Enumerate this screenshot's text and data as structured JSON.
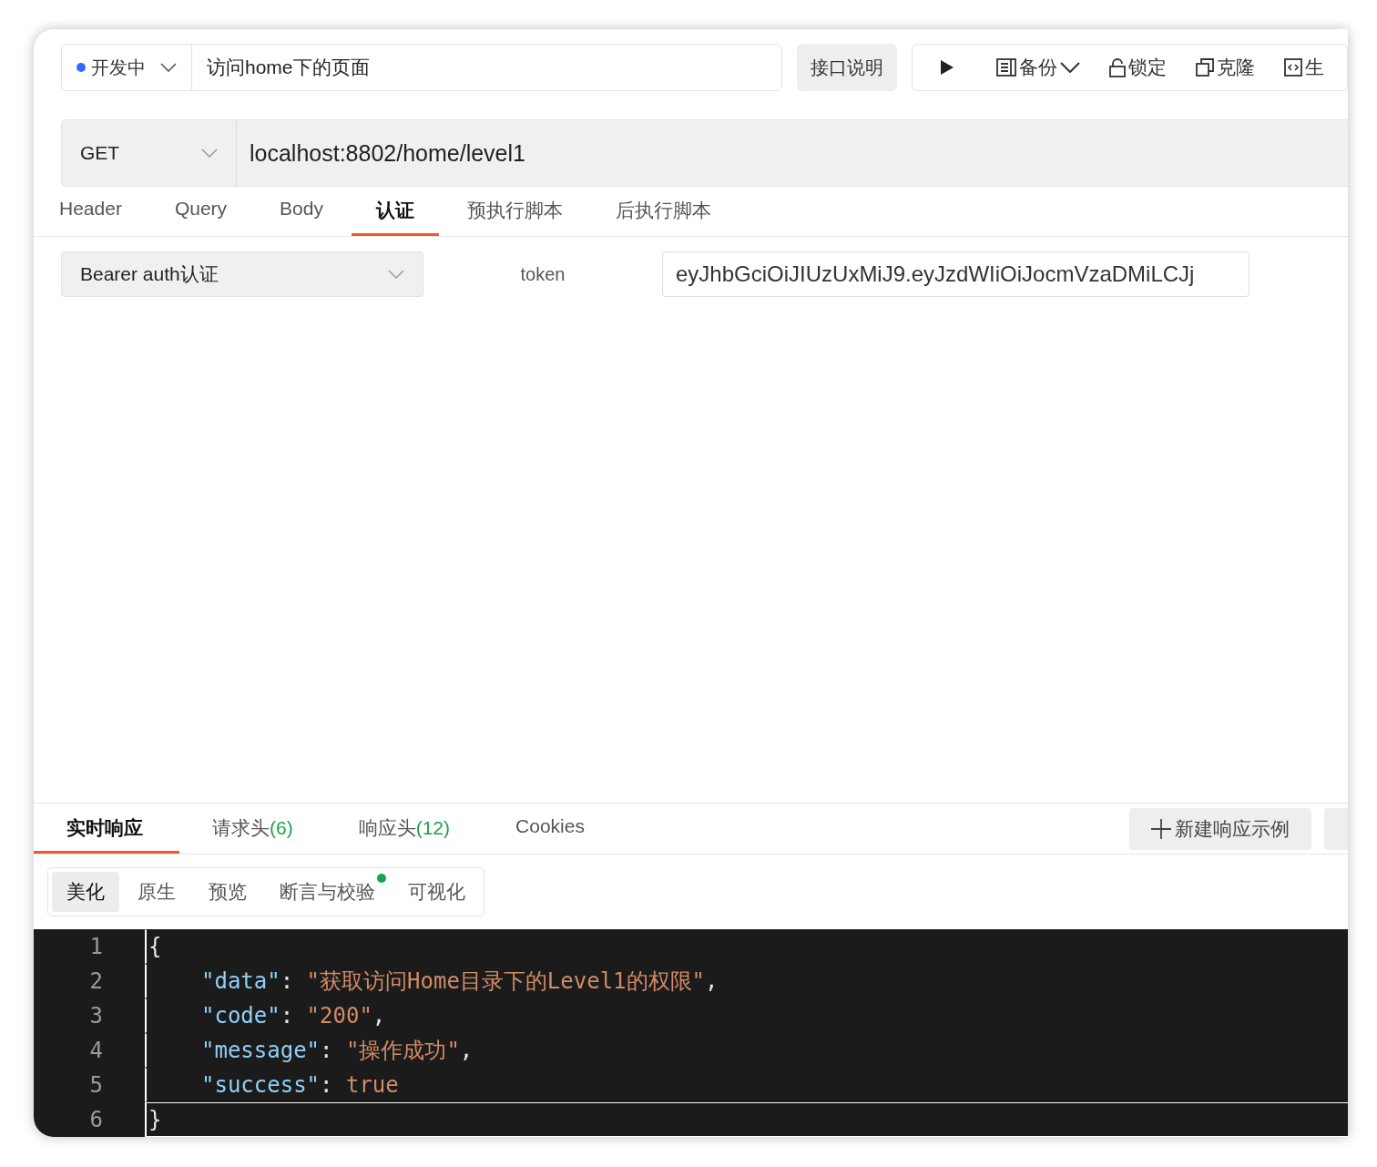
{
  "toolbar": {
    "status": {
      "label": "开发中",
      "color": "#2f6bff"
    },
    "title_field": {
      "value": "访问home下的页面"
    },
    "doc_button": "接口说明",
    "actions": [
      {
        "kind": "run"
      },
      {
        "kind": "backup",
        "label": "备份"
      },
      {
        "kind": "lock",
        "label": "锁定"
      },
      {
        "kind": "clone",
        "label": "克隆"
      },
      {
        "kind": "generate",
        "label": "生"
      }
    ]
  },
  "request": {
    "method": "GET",
    "url": "localhost:8802/home/level1"
  },
  "tabs": [
    {
      "label": "Header",
      "selected": false
    },
    {
      "label": "Query",
      "selected": false
    },
    {
      "label": "Body",
      "selected": false
    },
    {
      "label": "认证",
      "selected": true
    },
    {
      "label": "预执行脚本",
      "selected": false
    },
    {
      "label": "后执行脚本",
      "selected": false
    }
  ],
  "auth": {
    "type": "Bearer auth认证",
    "field_label": "token",
    "token": "eyJhbGciOiJIUzUxMiJ9.eyJzdWIiOiJocmVzaDMiLCJj"
  },
  "response_tabs": [
    {
      "label": "实时响应",
      "selected": true
    },
    {
      "label": "请求头",
      "count": "(6)",
      "selected": false
    },
    {
      "label": "响应头",
      "count": "(12)",
      "selected": false
    },
    {
      "label": "Cookies",
      "selected": false
    }
  ],
  "new_example_button": "新建响应示例",
  "view_tabs": [
    {
      "label": "美化",
      "selected": true,
      "badge": false
    },
    {
      "label": "原生",
      "selected": false,
      "badge": false
    },
    {
      "label": "预览",
      "selected": false,
      "badge": false
    },
    {
      "label": "断言与校验",
      "selected": false,
      "badge": true
    },
    {
      "label": "可视化",
      "selected": false,
      "badge": false
    }
  ],
  "code": [
    {
      "number": "1",
      "indented": false,
      "active": false,
      "tokens": [
        {
          "kind": "punct",
          "text": "{"
        }
      ]
    },
    {
      "number": "2",
      "indented": true,
      "active": false,
      "tokens": [
        {
          "kind": "key",
          "text": "\"data\""
        },
        {
          "kind": "punct",
          "text": ": "
        },
        {
          "kind": "string",
          "text": "\"获取访问Home目录下的Level1的权限\""
        },
        {
          "kind": "punct",
          "text": ","
        }
      ]
    },
    {
      "number": "3",
      "indented": true,
      "active": false,
      "tokens": [
        {
          "kind": "key",
          "text": "\"code\""
        },
        {
          "kind": "punct",
          "text": ": "
        },
        {
          "kind": "string",
          "text": "\"200\""
        },
        {
          "kind": "punct",
          "text": ","
        }
      ]
    },
    {
      "number": "4",
      "indented": true,
      "active": false,
      "tokens": [
        {
          "kind": "key",
          "text": "\"message\""
        },
        {
          "kind": "punct",
          "text": ": "
        },
        {
          "kind": "string",
          "text": "\"操作成功\""
        },
        {
          "kind": "punct",
          "text": ","
        }
      ]
    },
    {
      "number": "5",
      "indented": true,
      "active": false,
      "tokens": [
        {
          "kind": "key",
          "text": "\"success\""
        },
        {
          "kind": "punct",
          "text": ": "
        },
        {
          "kind": "bool",
          "text": "true"
        }
      ]
    },
    {
      "number": "6",
      "indented": false,
      "active": true,
      "tokens": [
        {
          "kind": "punct",
          "text": "}"
        }
      ]
    }
  ]
}
